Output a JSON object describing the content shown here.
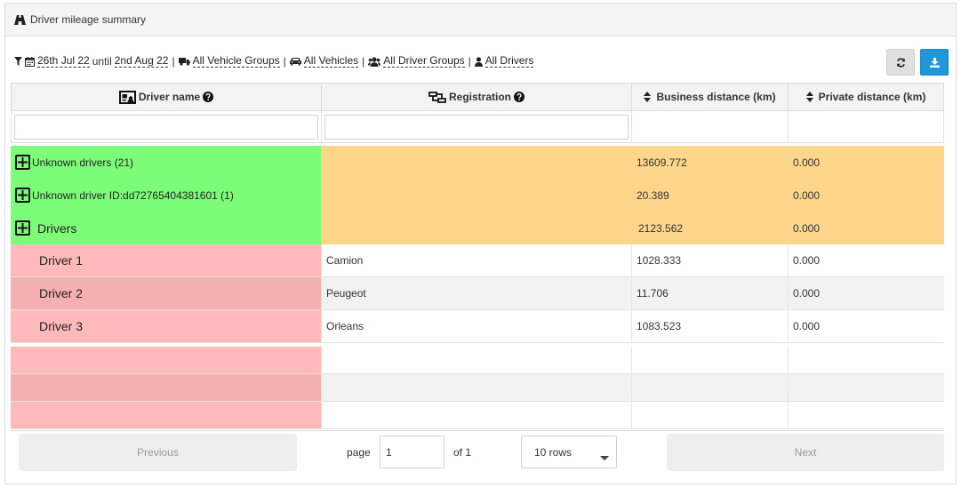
{
  "panel": {
    "title": "Driver mileage summary",
    "title_icon": "road-icon"
  },
  "filters": {
    "date_start": "26th Jul 22",
    "until_text": "until",
    "date_end": "2nd Aug 22",
    "vehicle_groups": "All Vehicle Groups",
    "vehicles": "All Vehicles",
    "driver_groups": "All Driver Groups",
    "drivers": "All Drivers",
    "separator": "|"
  },
  "toolbar": {
    "refresh_icon": "refresh-icon",
    "download_icon": "download-icon"
  },
  "table": {
    "columns": [
      {
        "label": "Driver name",
        "icon": "driver-card-icon"
      },
      {
        "label": "Registration",
        "icon": "registration-icon"
      },
      {
        "label": "Business distance (km)",
        "icon": "sort-icon"
      },
      {
        "label": "Private distance (km)",
        "icon": "sort-icon"
      }
    ],
    "groups": [
      {
        "name": "Unknown drivers (21)",
        "business": "13609.772",
        "private": "0.000"
      },
      {
        "name": "Unknown driver ID:dd72765404381601 (1)",
        "business": "20.389",
        "private": "0.000"
      },
      {
        "name": "Drivers",
        "business": "2123.562",
        "private": "0.000"
      }
    ],
    "rows": [
      {
        "driver": "Driver 1",
        "registration": "Camion",
        "business": "1028.333",
        "private": "0.000"
      },
      {
        "driver": "Driver 2",
        "registration": "Peugeot",
        "business": "11.706",
        "private": "0.000"
      },
      {
        "driver": "Driver 3",
        "registration": "Orleans",
        "business": "1083.523",
        "private": "0.000"
      }
    ]
  },
  "pagination": {
    "previous_label": "Previous",
    "next_label": "Next",
    "page_label": "page",
    "page_value": "1",
    "of_label": "of 1",
    "rows_option": "10 rows"
  }
}
